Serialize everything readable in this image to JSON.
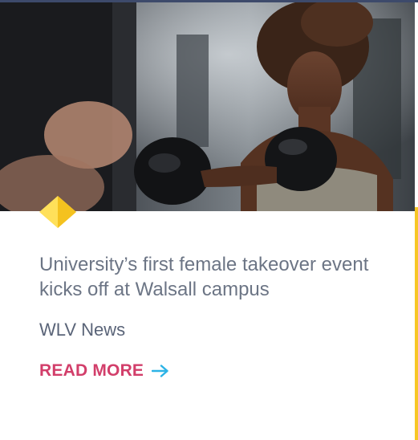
{
  "card": {
    "title": "University’s first female takeover event kicks off at Walsall campus",
    "source": "WLV News",
    "read_more_label": "READ MORE",
    "arrow_icon": "arrow-right-icon",
    "diamond_icon": "diamond-icon"
  },
  "colors": {
    "title": "#6c7585",
    "source": "#5a6478",
    "read_more": "#d23e6a",
    "arrow": "#2cb3e6",
    "diamond_light": "#ffe05a",
    "diamond_dark": "#f4c21f",
    "accent_bar": "#f7c726",
    "top_rule": "#3d4a6b"
  }
}
